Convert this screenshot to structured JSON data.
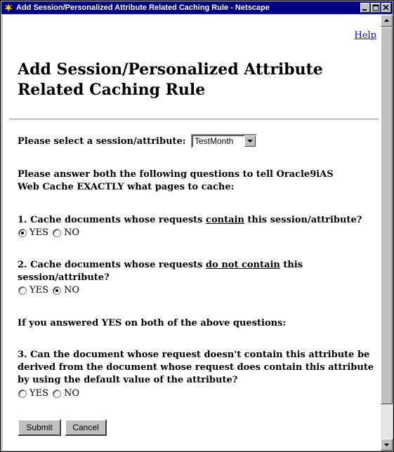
{
  "window": {
    "title": "Add Session/Personalized Attribute Related Caching Rule - Netscape"
  },
  "page": {
    "help_link": "Help",
    "heading": "Add Session/Personalized Attribute Related Caching Rule",
    "select_label": "Please select a session/attribute:",
    "select_value": "TestMonth",
    "intro_text": "Please answer both the following questions to tell Oracle9iAS Web Cache EXACTLY what pages to cache:",
    "q1": {
      "prefix": "1. Cache documents whose requests ",
      "emphasis": "contain",
      "suffix": " this session/attribute?",
      "yes": "YES",
      "no": "NO",
      "selected": "YES"
    },
    "q2": {
      "prefix": "2. Cache documents whose requests ",
      "emphasis": "do not contain",
      "suffix": " this session/attribute?",
      "yes": "YES",
      "no": "NO",
      "selected": "NO"
    },
    "condition_text": "If you answered YES on both of the above questions:",
    "q3": {
      "text": "3. Can the document whose request doesn't contain this attribute be derived from the document whose request does contain this attribute by using the default value of the attribute?",
      "yes": "YES",
      "no": "NO",
      "selected": ""
    },
    "submit_label": "Submit",
    "cancel_label": "Cancel"
  }
}
